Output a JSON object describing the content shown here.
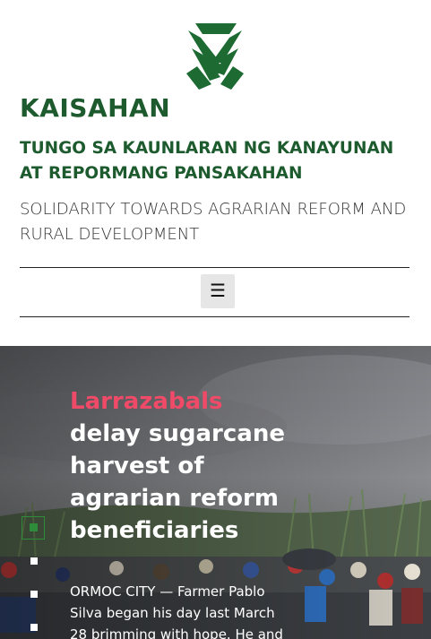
{
  "site": {
    "logo_icon": "kaisahan-logo-icon",
    "title": "KAISAHAN",
    "tagline_tl": "TUNGO SA KAUNLARAN NG KANAYUNAN AT REPORMANG PANSAKAHAN",
    "tagline_en": "SOLIDARITY TOWARDS AGRARIAN REFORM AND RURAL DEVELOPMENT",
    "brand_color": "#1d5b2e"
  },
  "nav": {
    "menu_icon": "☰"
  },
  "hero": {
    "title_accent": "Larrazabals",
    "title_rest": "delay sugarcane harvest of agrarian reform beneficiaries",
    "excerpt": "ORMOC CITY — Farmer Pablo Silva began his day last March 28 brimming with hope. He and his",
    "accent_color": "#ef4a68",
    "slide_count": 4,
    "active_slide": 1
  }
}
